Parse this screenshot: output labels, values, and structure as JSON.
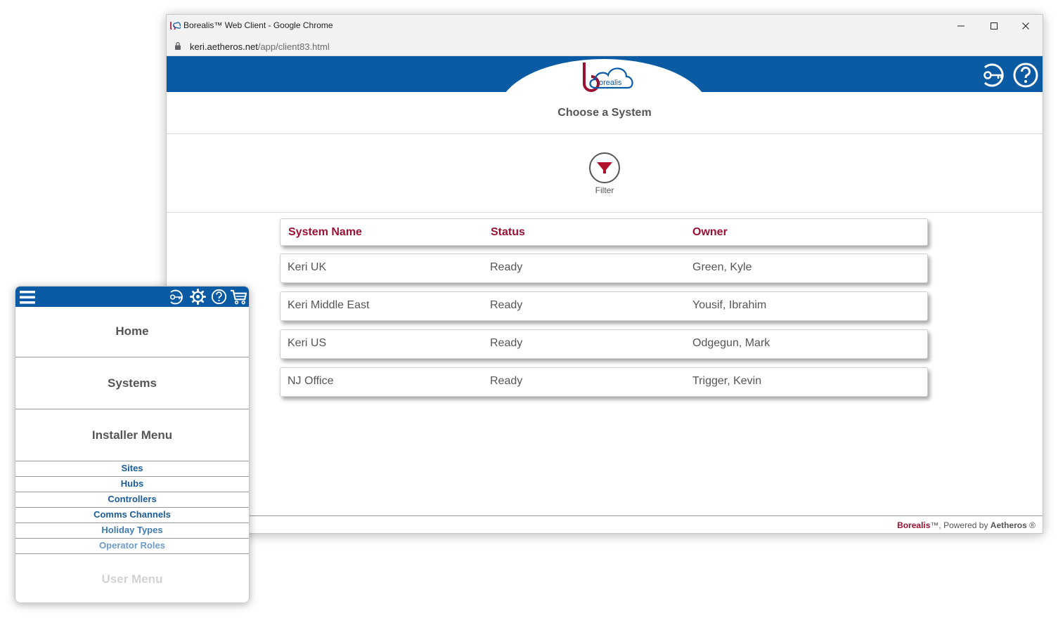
{
  "browser": {
    "title": "Borealis™ Web Client - Google Chrome",
    "url_host": "keri.aetheros.net",
    "url_path": "/app/client83.html"
  },
  "header": {
    "logo_text": "orealis",
    "icons": [
      "key-icon",
      "help-icon"
    ]
  },
  "page": {
    "title": "Choose a System",
    "filter_label": "Filter"
  },
  "table": {
    "columns": [
      "System Name",
      "Status",
      "Owner"
    ],
    "rows": [
      {
        "name": "Keri UK",
        "status": "Ready",
        "owner": "Green, Kyle"
      },
      {
        "name": "Keri Middle East",
        "status": "Ready",
        "owner": "Yousif, Ibrahim"
      },
      {
        "name": "Keri US",
        "status": "Ready",
        "owner": "Odgegun, Mark"
      },
      {
        "name": "NJ Office",
        "status": "Ready",
        "owner": "Trigger, Kevin"
      }
    ]
  },
  "footer": {
    "brand": "Borealis",
    "middle": "™, Powered by ",
    "company": "Aetheros",
    "suffix": " ®"
  },
  "mobile_menu": {
    "icons": [
      "hamburger-icon",
      "key-icon",
      "gear-icon",
      "help-icon",
      "cart-icon"
    ],
    "home": "Home",
    "systems": "Systems",
    "installer_menu": "Installer Menu",
    "sub_items": [
      "Sites",
      "Hubs",
      "Controllers",
      "Comms Channels",
      "Holiday Types",
      "Operator Roles"
    ],
    "user_menu": "User Menu"
  },
  "colors": {
    "header_blue": "#0a5ba3",
    "brand_red": "#9b1132",
    "text_gray": "#555555"
  }
}
